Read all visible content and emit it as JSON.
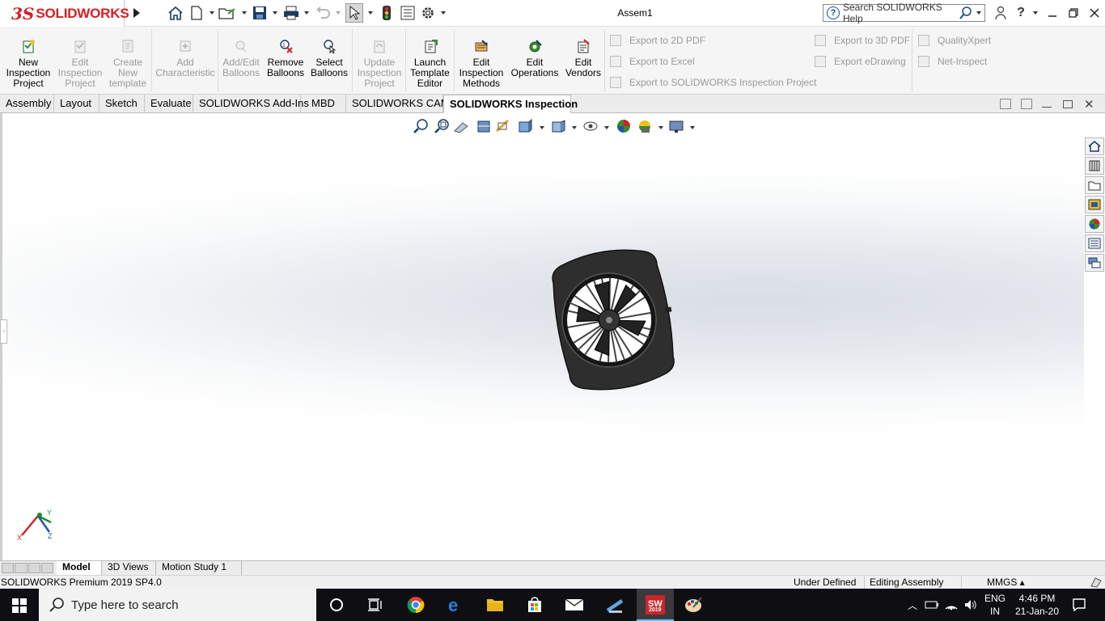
{
  "app": {
    "logo_ds": "3S",
    "logo_text": "SOLIDWORKS",
    "doc_title": "Assem1",
    "search_placeholder": "Search SOLIDWORKS Help"
  },
  "ribbon": {
    "buttons": [
      {
        "label": "New\nInspection\nProject",
        "enabled": true,
        "icon": "new-inspection-project-icon"
      },
      {
        "label": "Edit\nInspection\nProject",
        "enabled": false,
        "icon": "edit-inspection-project-icon"
      },
      {
        "label": "Create\nNew\ntemplate",
        "enabled": false,
        "icon": "create-template-icon"
      },
      {
        "label": "Add\nCharacteristic",
        "enabled": false,
        "icon": "add-characteristic-icon"
      },
      {
        "label": "Add/Edit\nBalloons",
        "enabled": false,
        "icon": "add-edit-balloons-icon"
      },
      {
        "label": "Remove\nBalloons",
        "enabled": true,
        "icon": "remove-balloons-icon"
      },
      {
        "label": "Select\nBalloons",
        "enabled": true,
        "icon": "select-balloons-icon"
      },
      {
        "label": "Update\nInspection\nProject",
        "enabled": false,
        "icon": "update-inspection-project-icon"
      },
      {
        "label": "Launch\nTemplate\nEditor",
        "enabled": true,
        "icon": "launch-template-editor-icon"
      },
      {
        "label": "Edit\nInspection\nMethods",
        "enabled": true,
        "icon": "edit-inspection-methods-icon"
      },
      {
        "label": "Edit\nOperations",
        "enabled": true,
        "icon": "edit-operations-icon"
      },
      {
        "label": "Edit\nVendors",
        "enabled": true,
        "icon": "edit-vendors-icon"
      }
    ],
    "export_2d": "Export to 2D PDF",
    "export_excel": "Export to Excel",
    "export_project": "Export to SOLIDWORKS Inspection Project",
    "export_3d": "Export to 3D PDF",
    "export_edrawing": "Export eDrawing",
    "qualityxpert": "QualityXpert",
    "net_inspect": "Net-Inspect"
  },
  "tabs": [
    "Assembly",
    "Layout",
    "Sketch",
    "Evaluate",
    "SOLIDWORKS Add-Ins",
    "MBD",
    "SOLIDWORKS CAM",
    "SOLIDWORKS Inspection"
  ],
  "active_tab": "SOLIDWORKS Inspection",
  "triad": {
    "x": "X",
    "y": "Y",
    "z": "Z"
  },
  "bottom_tabs": [
    "Model",
    "3D Views",
    "Motion Study 1"
  ],
  "status": {
    "product": "SOLIDWORKS Premium 2019 SP4.0",
    "state": "Under Defined",
    "mode": "Editing Assembly",
    "units": "MMGS"
  },
  "taskbar": {
    "search_placeholder": "Type here to search",
    "lang_top": "ENG",
    "lang_bottom": "IN",
    "time": "4:46 PM",
    "date": "21-Jan-20",
    "sw_badge": "2019"
  },
  "colors": {
    "brand_red": "#d41f26",
    "taskbar_bg": "#0f0f13",
    "accent_blue": "#1a4b8c"
  }
}
